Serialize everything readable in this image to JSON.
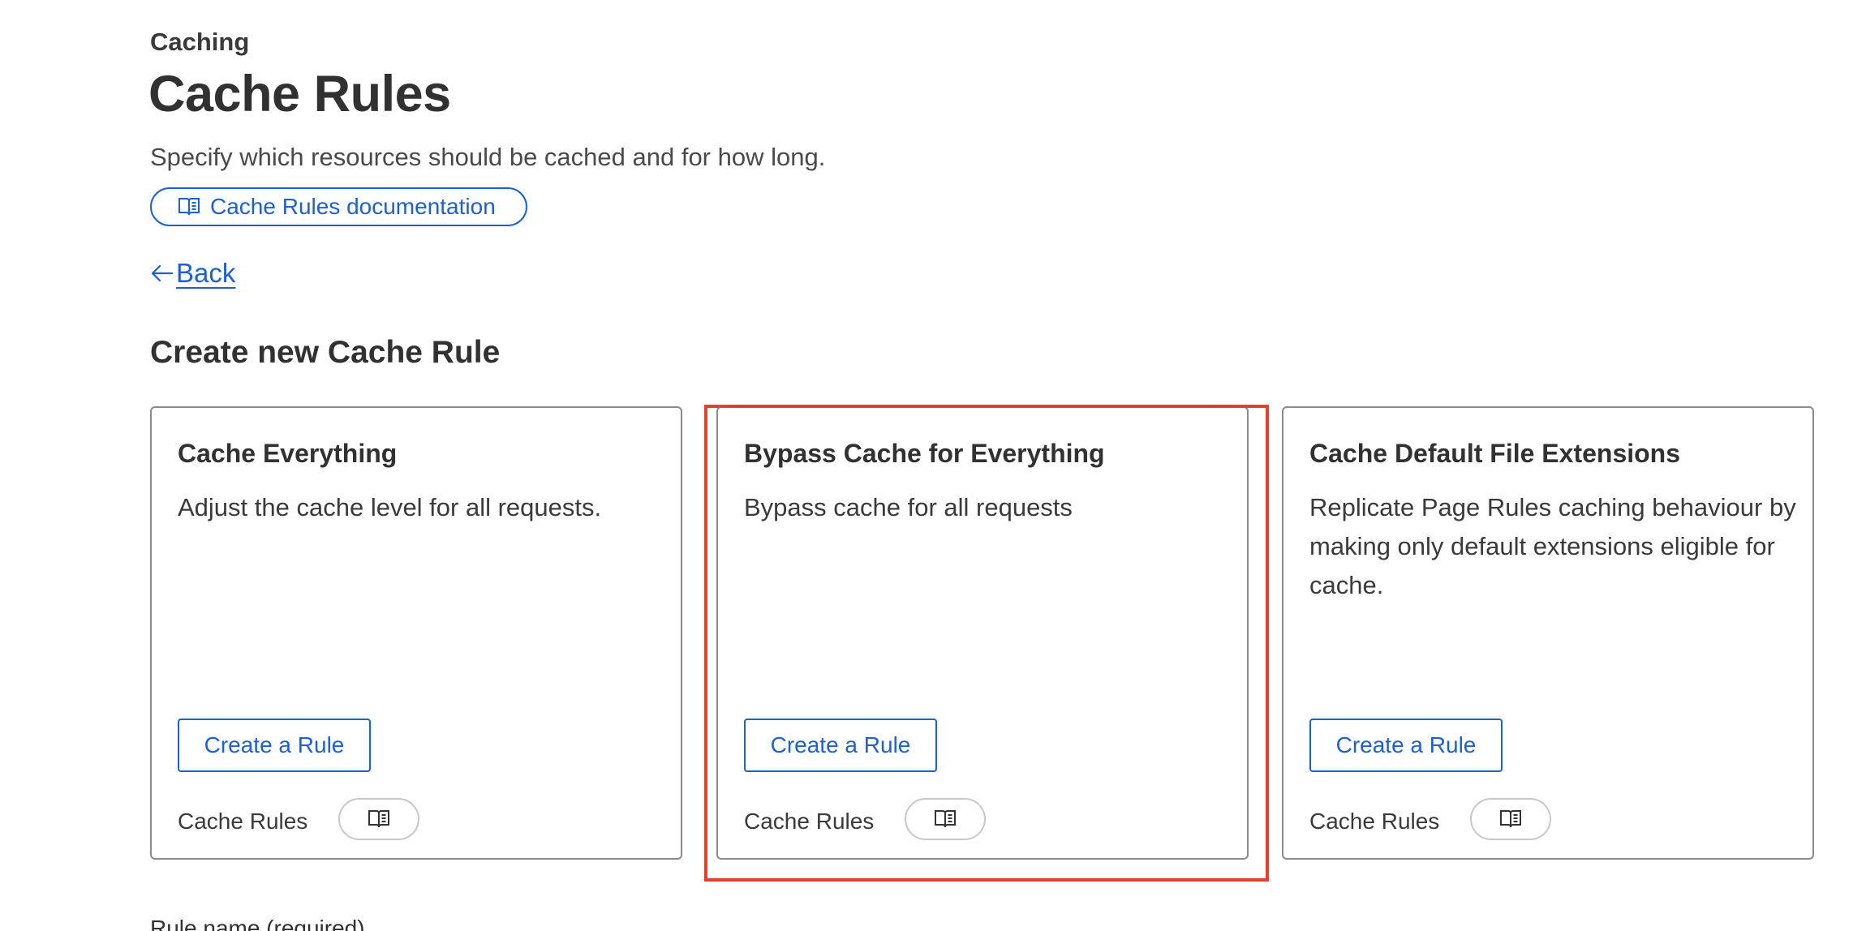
{
  "header": {
    "breadcrumb": "Caching",
    "title": "Cache Rules",
    "subtitle": "Specify which resources should be cached and for how long.",
    "doc_link_label": "Cache Rules documentation",
    "back_label": "Back"
  },
  "section": {
    "title": "Create new Cache Rule"
  },
  "cards": [
    {
      "title": "Cache Everything",
      "description": "Adjust the cache level for all requests.",
      "button_label": "Create a Rule",
      "footer_label": "Cache Rules",
      "footer_icon": "book-icon"
    },
    {
      "title": "Bypass Cache for Everything",
      "description": "Bypass cache for all requests",
      "button_label": "Create a Rule",
      "footer_label": "Cache Rules",
      "footer_icon": "book-icon",
      "highlighted": true
    },
    {
      "title": "Cache Default File Extensions",
      "description": "Replicate Page Rules caching behaviour by making only default extensions eligible for cache.",
      "button_label": "Create a Rule",
      "footer_label": "Cache Rules",
      "footer_icon": "book-icon"
    }
  ],
  "form": {
    "rule_name_label": "Rule name (required)"
  },
  "colors": {
    "accent": "#1d60d6",
    "highlight": "#e3412b",
    "text": "#313131",
    "border": "#8b8b8b"
  }
}
